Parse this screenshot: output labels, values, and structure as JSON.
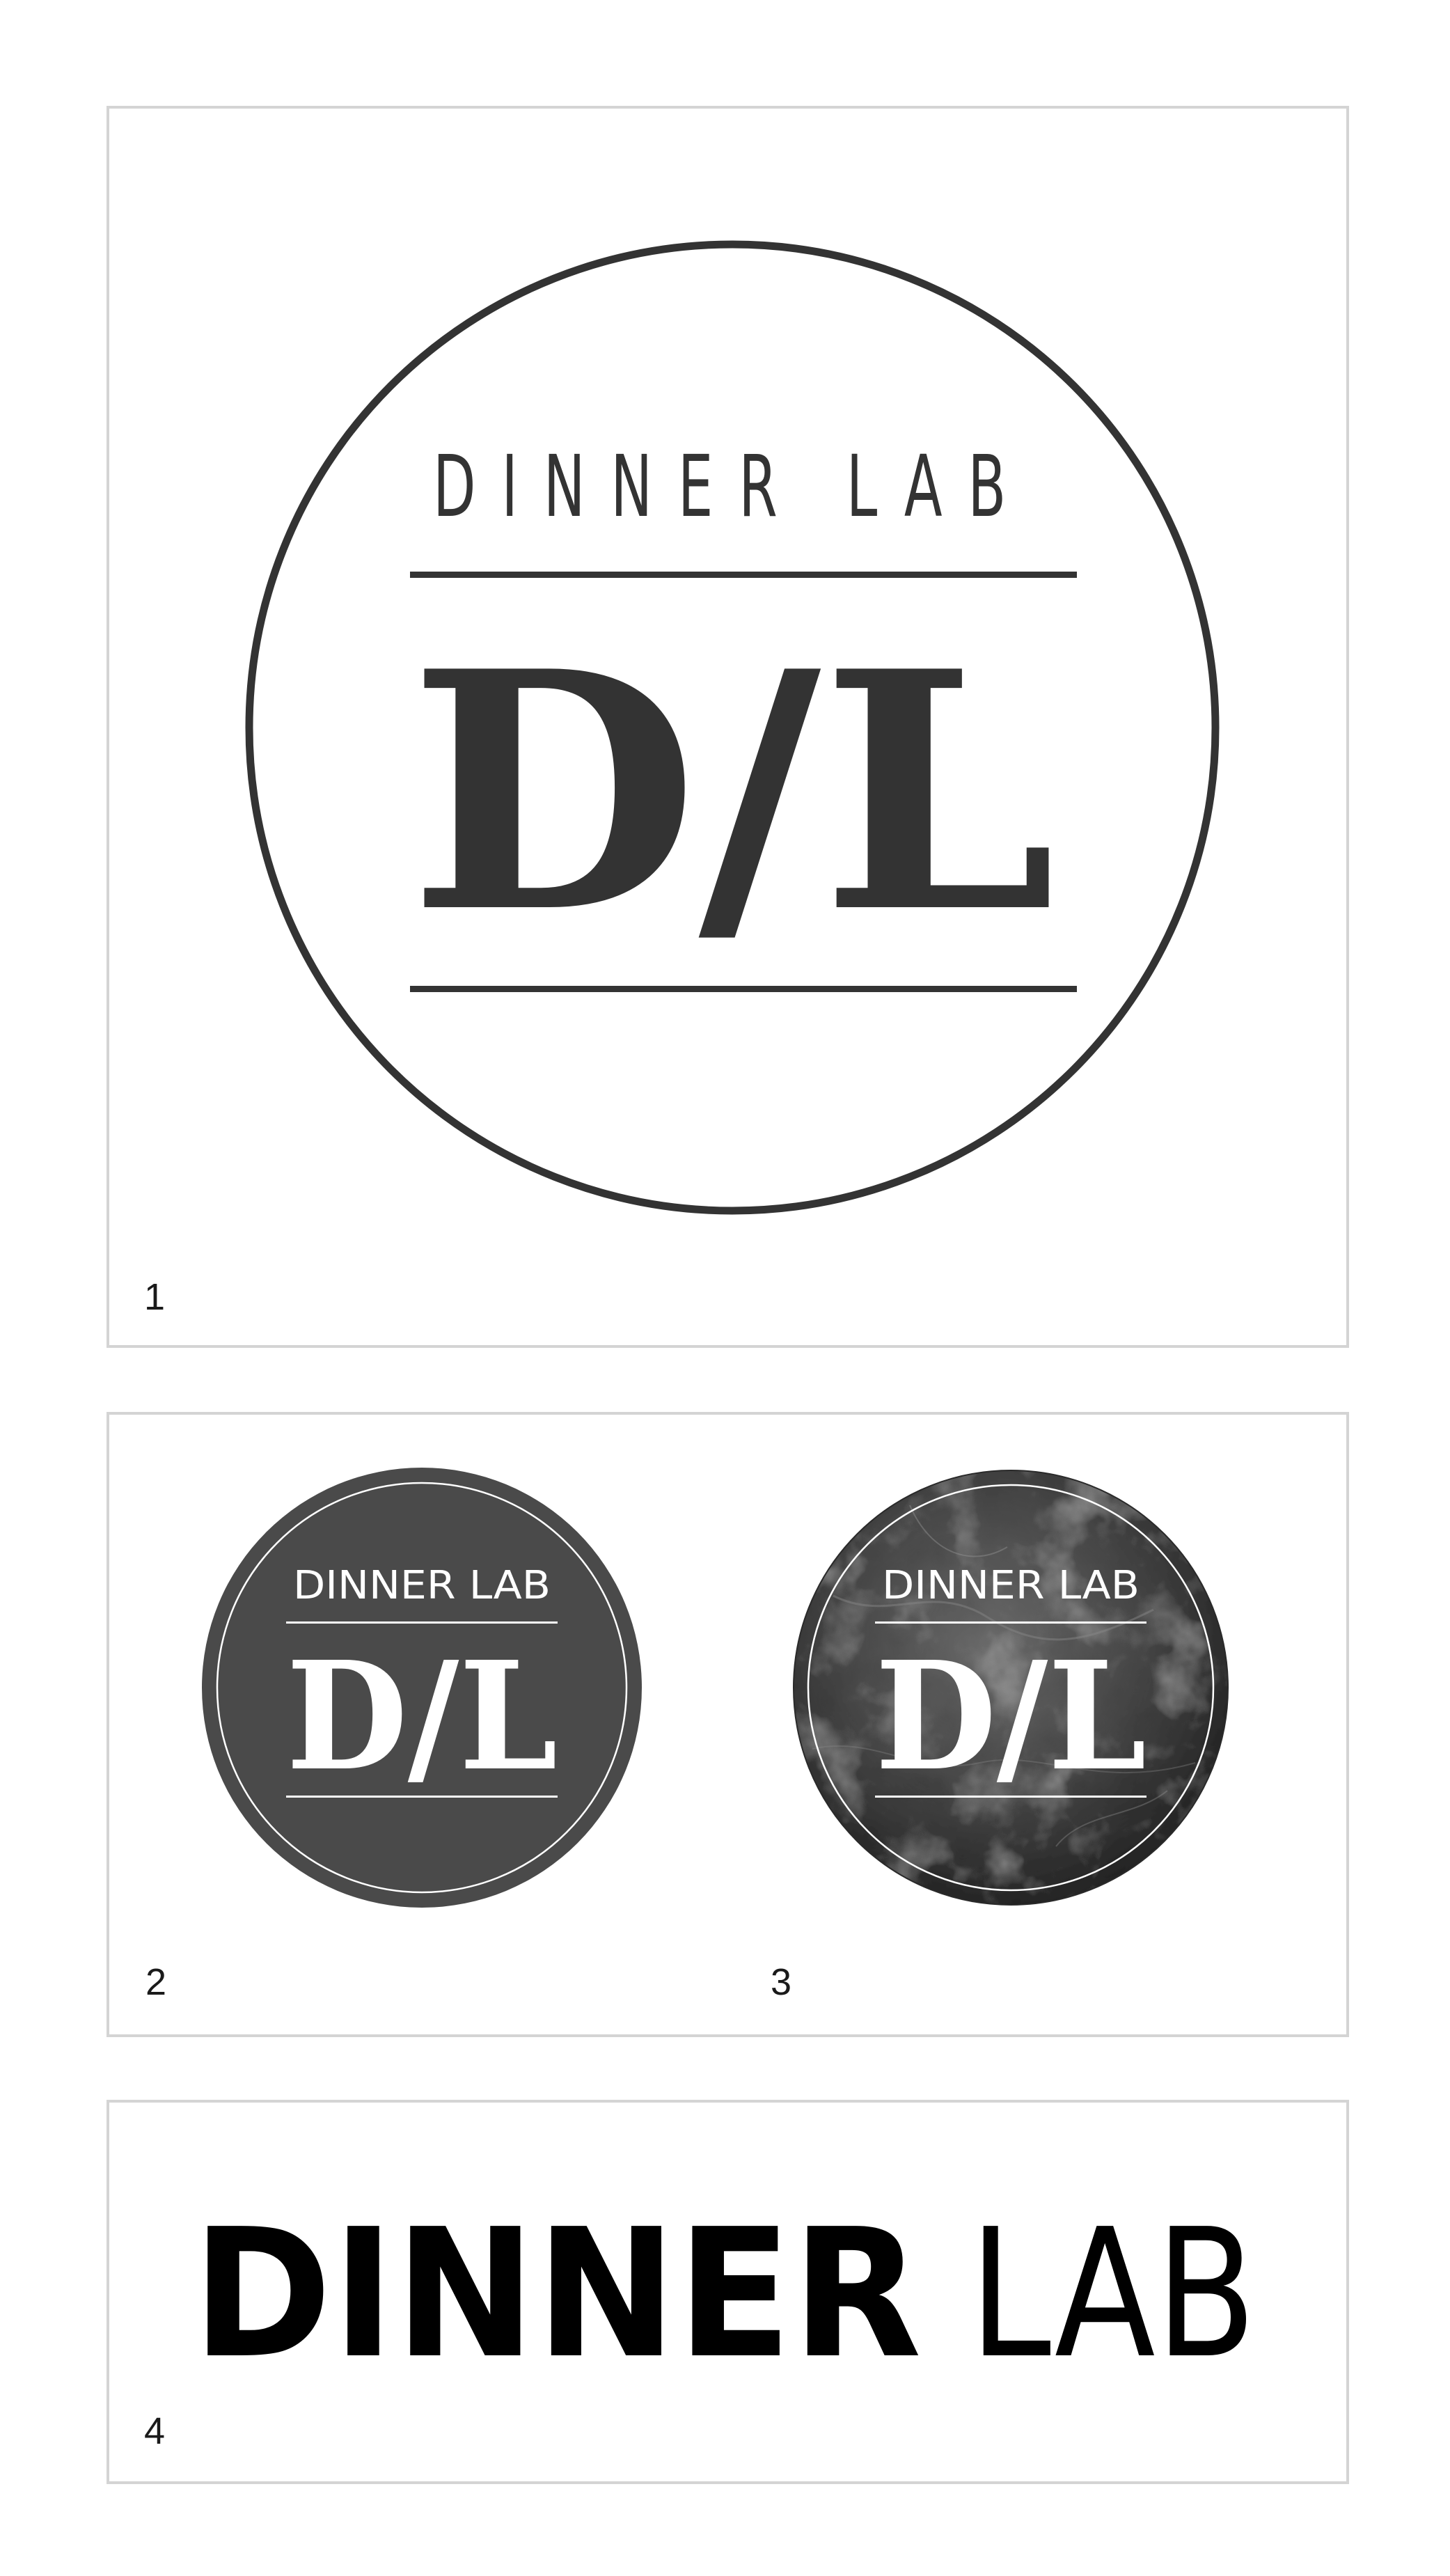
{
  "colors": {
    "logo_dark": "#333333",
    "badge_fill": "#4a4a4a",
    "badge_texture_base": "#3a3a3a",
    "badge_text": "#ffffff",
    "wordmark": "#000000",
    "panel_border": "#d4d4d4",
    "number_text": "#1a1a1a"
  },
  "panels": [
    {
      "number": "1",
      "variant": "outlined-circle-logo",
      "logo": {
        "wordmark": "DINNER LAB",
        "monogram": "D/L"
      }
    },
    {
      "number": "2",
      "variant": "solid-gray-badge",
      "logo": {
        "wordmark": "DINNER LAB",
        "monogram": "D/L"
      }
    },
    {
      "number": "3",
      "variant": "textured-stone-badge",
      "logo": {
        "wordmark": "DINNER LAB",
        "monogram": "D/L"
      }
    },
    {
      "number": "4",
      "variant": "horizontal-wordmark",
      "logo": {
        "bold_word": "DINNER",
        "light_word": "LAB"
      }
    }
  ]
}
